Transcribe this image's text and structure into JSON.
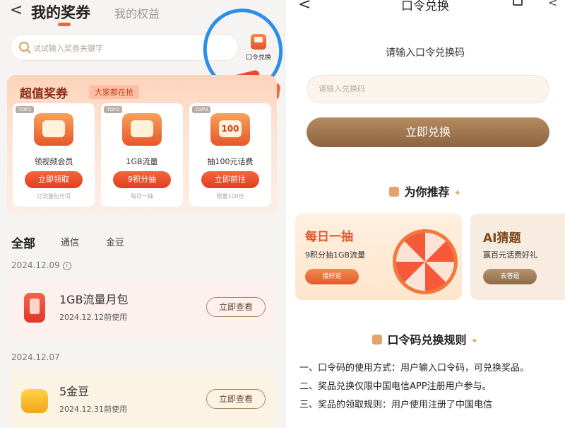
{
  "left": {
    "tabs": {
      "active": "我的奖券",
      "inactive": "我的权益"
    },
    "search_placeholder": "试试输入奖券关键字",
    "kouling_button": "口令兑换",
    "super": {
      "title": "超值奖券",
      "tag": "大家都在抢",
      "cards": [
        {
          "badge": "TOP1",
          "name": "领视频会员",
          "button": "立即领取",
          "sub": "订流量包可得"
        },
        {
          "badge": "TOP2",
          "name": "1GB流量",
          "button": "9积分抽",
          "sub": "每日一抽"
        },
        {
          "badge": "TOP3",
          "name": "抽100元话费",
          "button": "立即前往",
          "sub": "限量100份",
          "icon_text": "100"
        }
      ]
    },
    "categories": {
      "active": "全部",
      "items": [
        "通信",
        "金豆"
      ]
    },
    "groups": [
      {
        "date": "2024.12.09",
        "info_icon": "ⓘ",
        "title": "1GB流量月包",
        "expire": "2024.12.12前使用",
        "button": "立即查看"
      },
      {
        "date": "2024.12.07",
        "title": "5金豆",
        "expire": "2024.12.31前使用",
        "button": "立即查看"
      }
    ]
  },
  "right": {
    "title": "口令兑换",
    "prompt": "请输入口令兑换码",
    "input_placeholder": "请输入兑换码",
    "redeem_button": "立即兑换",
    "recommend_title": "为你推荐",
    "promo1": {
      "title": "每日一抽",
      "subtitle": "9积分抽1GB流量",
      "button": "接好运"
    },
    "promo2": {
      "title": "AI猜题",
      "subtitle": "赢百元话费好礼",
      "button": "去答题"
    },
    "rules_title": "口令码兑换规则",
    "rules": [
      "一、口令码的使用方式：用户输入口令码，可兑换奖品。",
      "二、奖品兑换仅限中国电信APP注册用户参与。",
      "三、奖品的领取规则：用户使用注册了中国电信"
    ]
  }
}
